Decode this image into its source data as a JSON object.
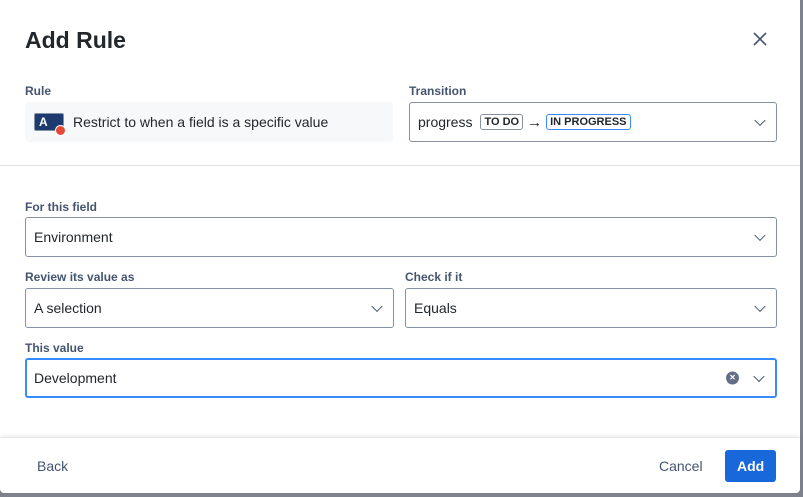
{
  "dialog": {
    "title": "Add Rule"
  },
  "rule": {
    "label": "Rule",
    "icon_letter": "A",
    "text": "Restrict to when a field is a specific value"
  },
  "transition": {
    "label": "Transition",
    "name": "progress",
    "from": "TO DO",
    "arrow": "→",
    "to": "IN PROGRESS"
  },
  "field": {
    "label": "For this field",
    "value": "Environment"
  },
  "review": {
    "label": "Review its value as",
    "value": "A selection"
  },
  "check": {
    "label": "Check if it",
    "value": "Equals"
  },
  "this_value": {
    "label": "This value",
    "value": "Development"
  },
  "footer": {
    "back": "Back",
    "cancel": "Cancel",
    "add": "Add"
  },
  "colors": {
    "primary": "#1868db",
    "focus": "#388bff"
  }
}
